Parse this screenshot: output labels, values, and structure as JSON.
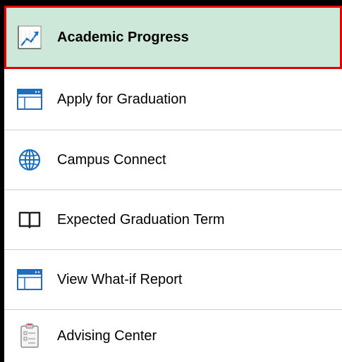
{
  "menu": {
    "items": [
      {
        "label": "Academic Progress",
        "icon": "trend-chart-icon",
        "selected": true
      },
      {
        "label": "Apply for Graduation",
        "icon": "window-icon",
        "selected": false
      },
      {
        "label": "Campus Connect",
        "icon": "globe-icon",
        "selected": false
      },
      {
        "label": "Expected Graduation Term",
        "icon": "book-icon",
        "selected": false
      },
      {
        "label": "View What-if Report",
        "icon": "window-icon",
        "selected": false
      },
      {
        "label": "Advising Center",
        "icon": "clipboard-icon",
        "selected": false
      }
    ]
  },
  "colors": {
    "selected_background": "#cde7d8",
    "selected_border": "#e60000",
    "icon_blue": "#1b6fc2",
    "icon_dark": "#333333"
  }
}
